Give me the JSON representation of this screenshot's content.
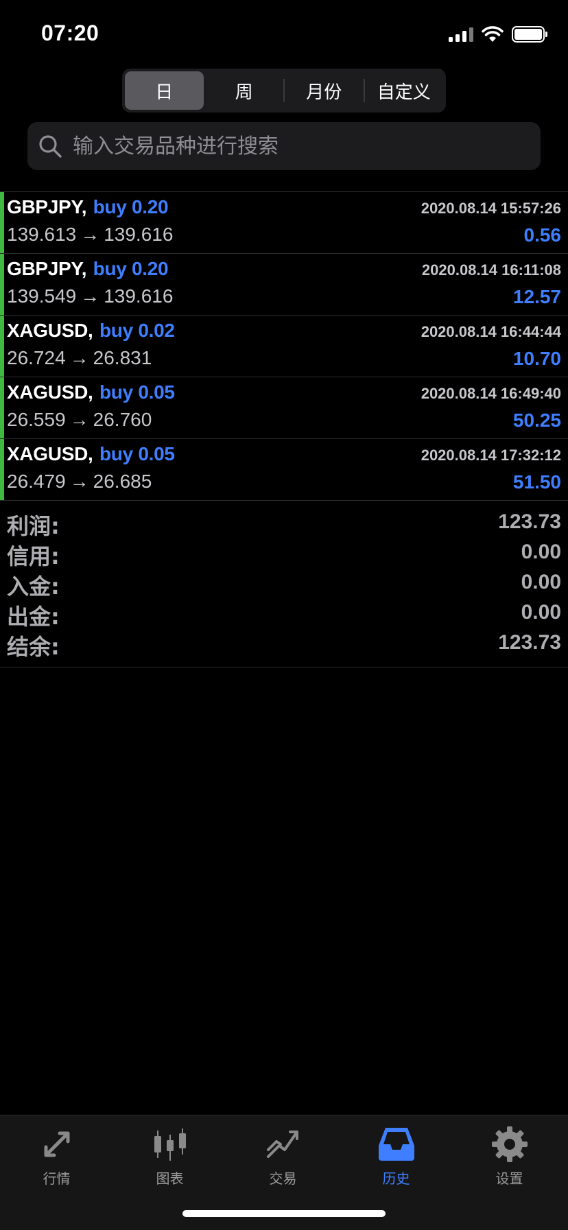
{
  "status_bar": {
    "time": "07:20"
  },
  "period_tabs": [
    {
      "label": "日",
      "active": true
    },
    {
      "label": "周",
      "active": false
    },
    {
      "label": "月份",
      "active": false
    },
    {
      "label": "自定义",
      "active": false
    }
  ],
  "search": {
    "placeholder": "输入交易品种进行搜索",
    "value": ""
  },
  "trades": [
    {
      "symbol": "GBPJPY,",
      "side": "buy 0.20",
      "time": "2020.08.14 15:57:26",
      "open_price": "139.613",
      "close_price": "139.616",
      "arrow": "→",
      "profit": "0.56"
    },
    {
      "symbol": "GBPJPY,",
      "side": "buy 0.20",
      "time": "2020.08.14 16:11:08",
      "open_price": "139.549",
      "close_price": "139.616",
      "arrow": "→",
      "profit": "12.57"
    },
    {
      "symbol": "XAGUSD,",
      "side": "buy 0.02",
      "time": "2020.08.14 16:44:44",
      "open_price": "26.724",
      "close_price": "26.831",
      "arrow": "→",
      "profit": "10.70"
    },
    {
      "symbol": "XAGUSD,",
      "side": "buy 0.05",
      "time": "2020.08.14 16:49:40",
      "open_price": "26.559",
      "close_price": "26.760",
      "arrow": "→",
      "profit": "50.25"
    },
    {
      "symbol": "XAGUSD,",
      "side": "buy 0.05",
      "time": "2020.08.14 17:32:12",
      "open_price": "26.479",
      "close_price": "26.685",
      "arrow": "→",
      "profit": "51.50"
    }
  ],
  "summary": [
    {
      "label": "利润:",
      "value": "123.73"
    },
    {
      "label": "信用:",
      "value": "0.00"
    },
    {
      "label": "入金:",
      "value": "0.00"
    },
    {
      "label": "出金:",
      "value": "0.00"
    },
    {
      "label": "结余:",
      "value": "123.73"
    }
  ],
  "tab_bar": [
    {
      "label": "行情",
      "icon": "quotes-icon",
      "active": false
    },
    {
      "label": "图表",
      "icon": "chart-icon",
      "active": false
    },
    {
      "label": "交易",
      "icon": "trade-icon",
      "active": false
    },
    {
      "label": "历史",
      "icon": "history-icon",
      "active": true
    },
    {
      "label": "设置",
      "icon": "settings-icon",
      "active": false
    }
  ],
  "colors": {
    "accent_blue": "#3f7fff",
    "buy_bar_green": "#3fb93f",
    "background": "#000000"
  }
}
